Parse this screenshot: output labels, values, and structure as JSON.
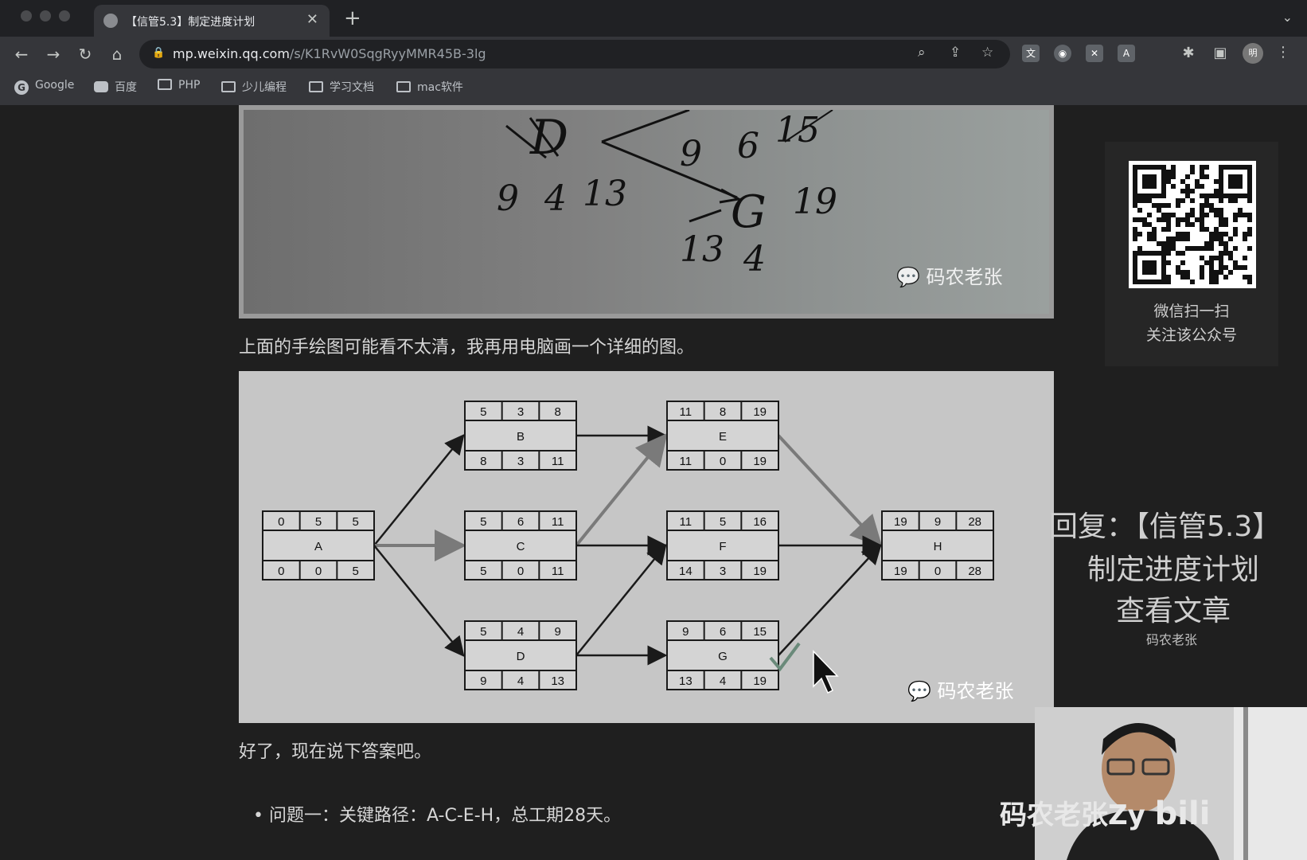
{
  "browser": {
    "tab_title": "【信管5.3】制定进度计划",
    "url_host": "mp.weixin.qq.com",
    "url_path": "/s/K1RvW0SqgRyyMMR45B-3lg",
    "profile_initial": "明",
    "bookmarks": [
      "Google",
      "百度",
      "PHP",
      "少儿编程",
      "学习文档",
      "mac软件"
    ]
  },
  "article": {
    "photo_watermark": "码农老张",
    "handwritten": {
      "n1": "9",
      "n2": "4",
      "n3": "13",
      "d": "D",
      "n4": "9",
      "n5": "6",
      "n6": "15",
      "g": "G",
      "n7": "19",
      "n8": "13",
      "n9": "4"
    },
    "para1": "上面的手绘图可能看不太清，我再用电脑画一个详细的图。",
    "diagram_watermark": "码农老张",
    "para2": "好了，现在说下答案吧。",
    "bullet1": "问题一：关键路径：A-C-E-H，总工期28天。"
  },
  "network": {
    "nodes": [
      {
        "id": "A",
        "top": [
          "0",
          "5",
          "5"
        ],
        "bottom": [
          "0",
          "0",
          "5"
        ]
      },
      {
        "id": "B",
        "top": [
          "5",
          "3",
          "8"
        ],
        "bottom": [
          "8",
          "3",
          "11"
        ]
      },
      {
        "id": "C",
        "top": [
          "5",
          "6",
          "11"
        ],
        "bottom": [
          "5",
          "0",
          "11"
        ]
      },
      {
        "id": "D",
        "top": [
          "5",
          "4",
          "9"
        ],
        "bottom": [
          "9",
          "4",
          "13"
        ]
      },
      {
        "id": "E",
        "top": [
          "11",
          "8",
          "19"
        ],
        "bottom": [
          "11",
          "0",
          "19"
        ]
      },
      {
        "id": "F",
        "top": [
          "11",
          "5",
          "16"
        ],
        "bottom": [
          "14",
          "3",
          "19"
        ]
      },
      {
        "id": "G",
        "top": [
          "9",
          "6",
          "15"
        ],
        "bottom": [
          "13",
          "4",
          "19"
        ]
      },
      {
        "id": "H",
        "top": [
          "19",
          "9",
          "28"
        ],
        "bottom": [
          "19",
          "0",
          "28"
        ]
      }
    ],
    "edges": [
      {
        "from": "A",
        "to": "B",
        "critical": false
      },
      {
        "from": "A",
        "to": "C",
        "critical": true
      },
      {
        "from": "A",
        "to": "D",
        "critical": false
      },
      {
        "from": "B",
        "to": "E",
        "critical": false
      },
      {
        "from": "C",
        "to": "E",
        "critical": true
      },
      {
        "from": "C",
        "to": "F",
        "critical": false
      },
      {
        "from": "D",
        "to": "F",
        "critical": false
      },
      {
        "from": "D",
        "to": "G",
        "critical": false
      },
      {
        "from": "E",
        "to": "H",
        "critical": true
      },
      {
        "from": "F",
        "to": "H",
        "critical": false
      },
      {
        "from": "G",
        "to": "H",
        "critical": false
      }
    ]
  },
  "sidebar": {
    "qr_line1": "微信扫一扫",
    "qr_line2": "关注该公众号",
    "promo_line1": "回复：【信管5.3】",
    "promo_line2": "制定进度计划",
    "promo_line3": "查看文章",
    "promo_sub": "码农老张"
  },
  "overlay": {
    "streamer_text": "码农老张Zy"
  },
  "colors": {
    "critical_edge": "#7a7a7a",
    "normal_edge": "#1a1a1a",
    "checkmark": "#6a8a7a"
  }
}
